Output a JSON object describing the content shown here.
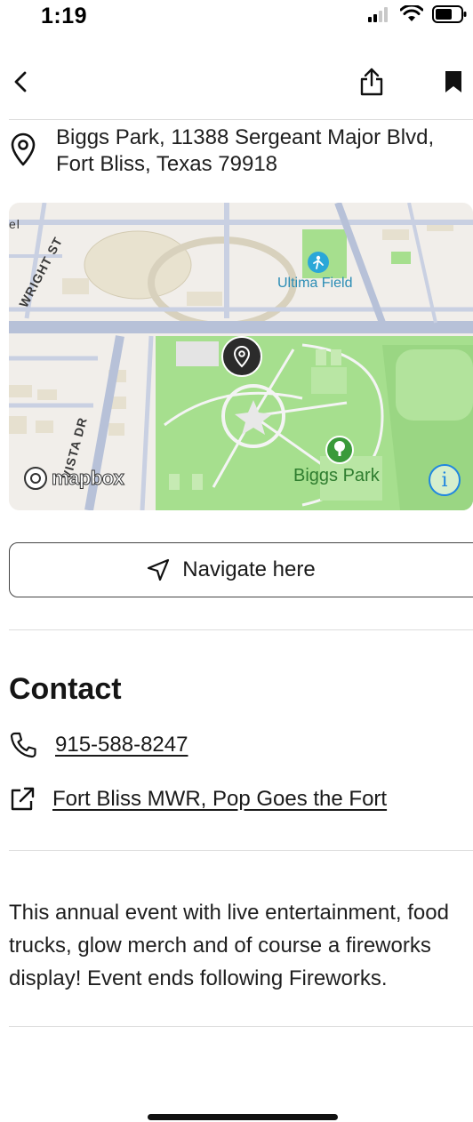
{
  "status_bar": {
    "time": "1:19",
    "icons": [
      "cellular-signal-icon",
      "wifi-icon",
      "battery-icon"
    ]
  },
  "nav": {
    "icons": [
      "chevron-left-icon",
      "share-icon",
      "bookmark-icon"
    ]
  },
  "location": {
    "address": "Biggs Park, 11388 Sergeant Major Blvd,\nFort Bliss, Texas 79918",
    "icon": "location-pin-icon"
  },
  "map": {
    "labels": {
      "poi_field": "Ultima Field",
      "poi_park": "Biggs Park",
      "street_1": "WRIGHT ST",
      "street_2": "VISTA DR",
      "street_edge": "el"
    },
    "attribution": "mapbox",
    "info_symbol": "i",
    "colors": {
      "land": "#f1eeea",
      "park": "#9fdc88",
      "road": "#b7c1d8",
      "building": "#e6e0cf",
      "pin": "#2b2b2b",
      "field_poi": "#2aa7d8",
      "park_poi": "#3a9a3a",
      "info": "#1f86e0"
    }
  },
  "navigate": {
    "label": "Navigate here",
    "icon": "navigation-arrow-icon"
  },
  "contact": {
    "heading": "Contact",
    "phone": "915-588-8247",
    "website": "Fort Bliss MWR, Pop Goes the Fort"
  },
  "description": "This annual event with live entertainment, food trucks, glow merch and of course a fireworks display! Event ends following Fireworks."
}
